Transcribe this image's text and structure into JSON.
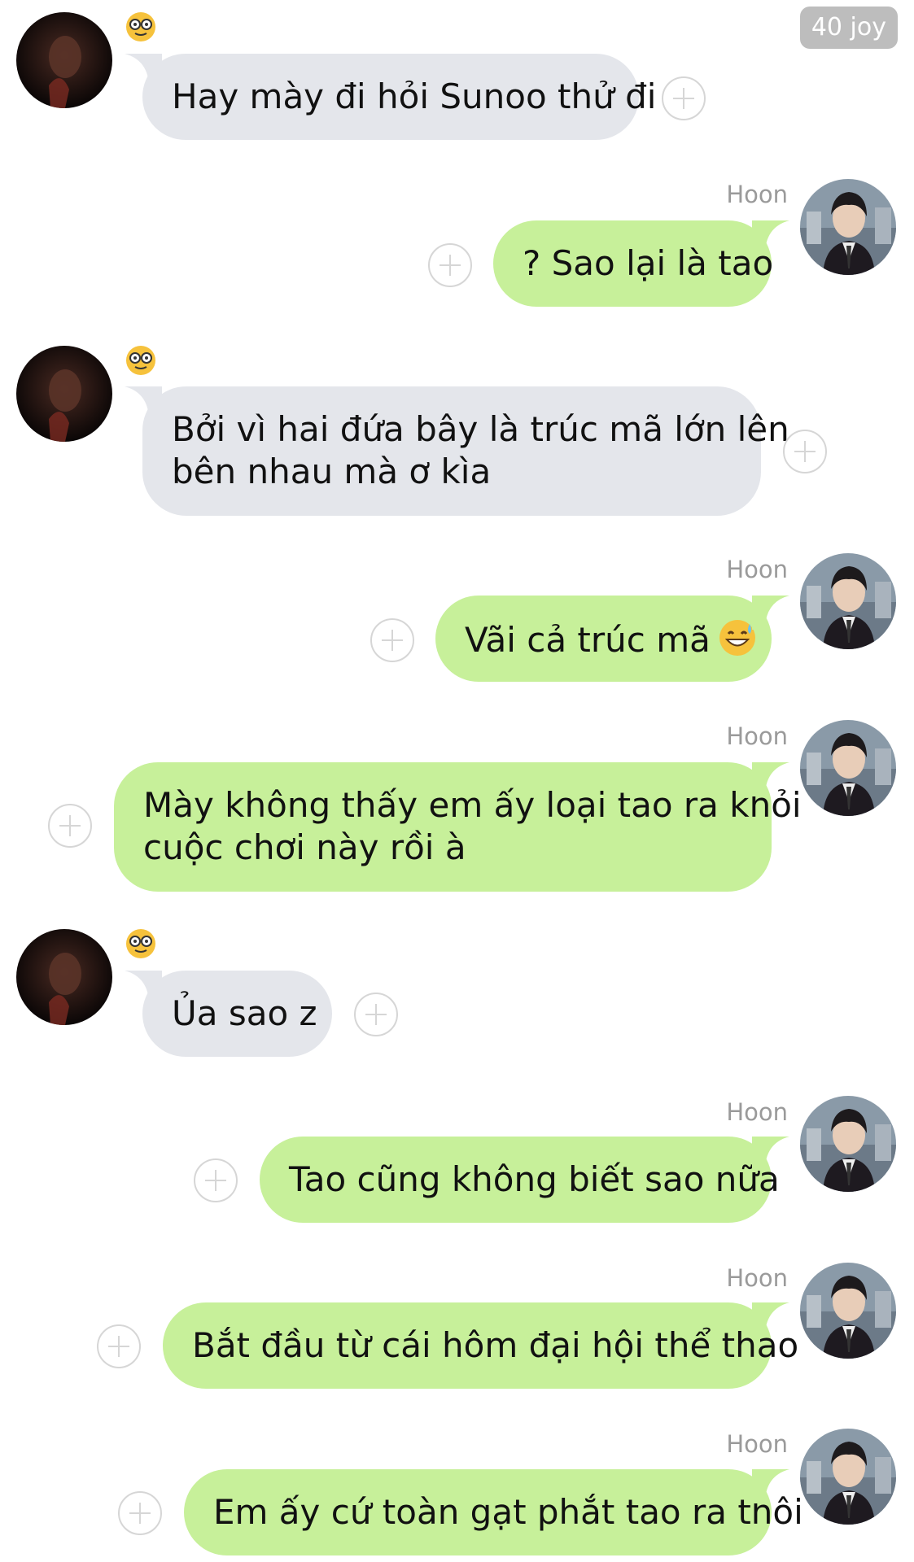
{
  "header": {
    "badge": "40 joy"
  },
  "sender_name": "Hoon",
  "messages": [
    {
      "side": "in",
      "lines": [
        "Hay mày đi hỏi Sunoo thử đi"
      ],
      "sender_icon": "nerd-face-emoji"
    },
    {
      "side": "out",
      "lines": [
        "? Sao lại là tao"
      ],
      "sender": "Hoon"
    },
    {
      "side": "in",
      "lines": [
        "Bởi vì hai đứa bây là trúc mã lớn lên",
        "bên nhau mà ơ kìa"
      ],
      "sender_icon": "nerd-face-emoji"
    },
    {
      "side": "out",
      "lines": [
        "Vãi cả trúc mã"
      ],
      "trailing_emoji": "grinning-sweat-emoji",
      "sender": "Hoon"
    },
    {
      "side": "out",
      "lines": [
        "Mày không thấy em ấy loại tao ra khỏi",
        "cuộc chơi này rồi à"
      ],
      "sender": "Hoon"
    },
    {
      "side": "in",
      "lines": [
        "Ủa sao z"
      ],
      "sender_icon": "nerd-face-emoji"
    },
    {
      "side": "out",
      "lines": [
        "Tao cũng không biết sao nữa"
      ],
      "sender": "Hoon"
    },
    {
      "side": "out",
      "lines": [
        "Bắt đầu từ cái hôm đại hội thể thao"
      ],
      "sender": "Hoon"
    },
    {
      "side": "out",
      "lines": [
        "Em ấy cứ toàn gạt phắt tao ra thôi"
      ],
      "sender": "Hoon"
    }
  ],
  "icons": {
    "add": "plus-circle-icon",
    "avatar_in": "dark-avatar",
    "avatar_out": "hoon-avatar"
  },
  "colors": {
    "incoming_bubble": "#e4e6eb",
    "outgoing_bubble": "#c7f09a",
    "name_text": "#9a9a9a",
    "badge_bg": "#bdbdbd"
  }
}
